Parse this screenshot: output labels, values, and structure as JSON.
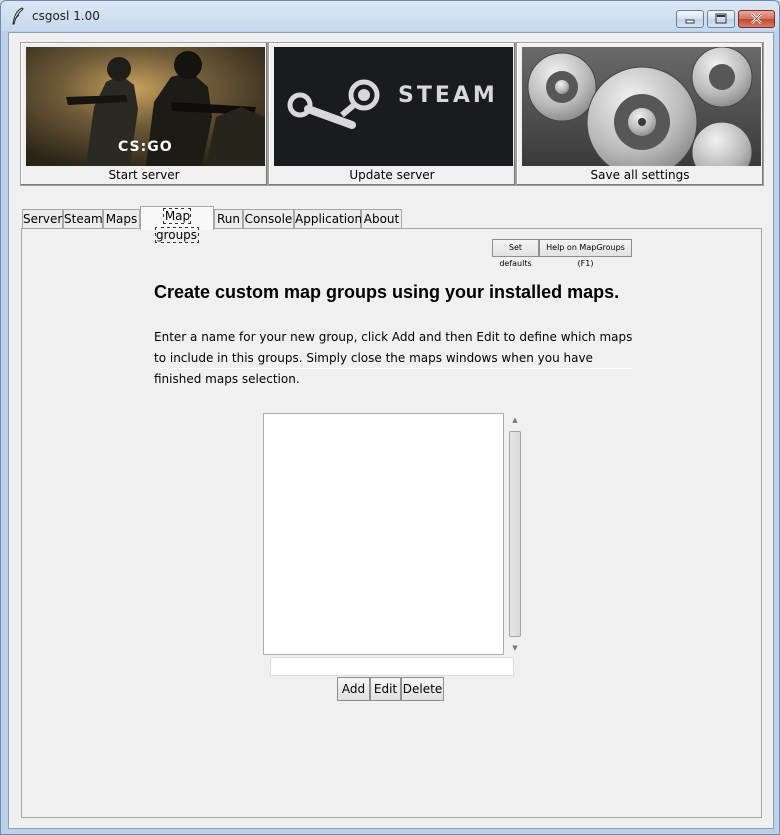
{
  "window": {
    "title": "csgosl 1.00"
  },
  "banners": [
    {
      "label": "Start server",
      "logo_text": "CS:GO"
    },
    {
      "label": "Update server",
      "logo_text": "STEAM"
    },
    {
      "label": "Save all settings"
    }
  ],
  "tabs": [
    {
      "label": "Server"
    },
    {
      "label": "Steam"
    },
    {
      "label": "Maps"
    },
    {
      "label": "Map groups",
      "active": true
    },
    {
      "label": "Run"
    },
    {
      "label": "Console"
    },
    {
      "label": "Application"
    },
    {
      "label": "About"
    }
  ],
  "mapgroups": {
    "set_defaults_label": "Set defaults",
    "help_label": "Help on MapGroups (F1)",
    "heading": "Create custom map groups using your installed maps.",
    "description": "Enter a name for your new group, click Add and then Edit to define which maps to include in this groups. Simply close the maps windows when you have finished maps selection.",
    "group_list": [],
    "name_input_value": "",
    "add_label": "Add",
    "edit_label": "Edit",
    "delete_label": "Delete"
  },
  "colors": {
    "window_frame": "#bcd0ea",
    "client_bg": "#f0f0f0",
    "steam_bg": "#1a1b1f",
    "close_button": "#c0462f"
  }
}
